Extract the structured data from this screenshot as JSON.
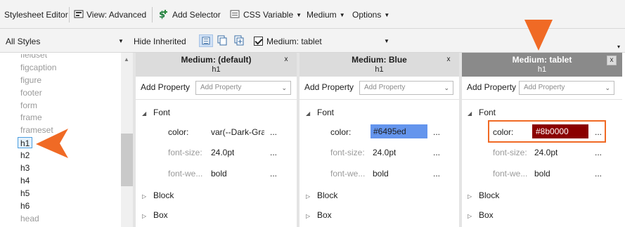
{
  "toolbar": {
    "title": "Stylesheet Editor",
    "view_label": "View: Advanced",
    "add_selector_label": "Add Selector",
    "css_variable_label": "CSS Variable",
    "medium_label": "Medium",
    "options_label": "Options"
  },
  "filter_bar": {
    "styles_value": "All Styles",
    "hide_inherited_label": "Hide Inherited",
    "medium_checkbox_label": "Medium: tablet"
  },
  "selector_list": {
    "items": [
      "fieldset",
      "figcaption",
      "figure",
      "footer",
      "form",
      "frame",
      "frameset",
      "h1",
      "h2",
      "h3",
      "h4",
      "h5",
      "h6",
      "head"
    ],
    "selected": "h1"
  },
  "columns": [
    {
      "title": "Medium: (default)",
      "subtitle": "h1",
      "add_property_label": "Add Property",
      "add_property_placeholder": "Add Property",
      "groups": [
        "Font",
        "Block",
        "Box"
      ],
      "props": [
        {
          "name": "color:",
          "value": "var(--Dark-Gra",
          "more": "..."
        },
        {
          "name": "font-size:",
          "value": "24.0pt",
          "more": "..."
        },
        {
          "name": "font-we...",
          "value": "bold",
          "more": "..."
        }
      ],
      "close": "x"
    },
    {
      "title": "Medium: Blue",
      "subtitle": "h1",
      "add_property_label": "Add Property",
      "add_property_placeholder": "Add Property",
      "groups": [
        "Font",
        "Block",
        "Box"
      ],
      "props": [
        {
          "name": "color:",
          "value": "#6495ed",
          "more": "..."
        },
        {
          "name": "font-size:",
          "value": "24.0pt",
          "more": "..."
        },
        {
          "name": "font-we...",
          "value": "bold",
          "more": "..."
        }
      ],
      "close": "x"
    },
    {
      "title": "Medium: tablet",
      "subtitle": "h1",
      "add_property_label": "Add Property",
      "add_property_placeholder": "Add Property",
      "groups": [
        "Font",
        "Block",
        "Box"
      ],
      "props": [
        {
          "name": "color:",
          "value": "#8b0000",
          "more": "..."
        },
        {
          "name": "font-size:",
          "value": "24.0pt",
          "more": "..."
        },
        {
          "name": "font-we...",
          "value": "bold",
          "more": "..."
        }
      ],
      "close": "x"
    }
  ],
  "colors": {
    "callout_orange": "#f06a25",
    "active_header": "#8a8a8a",
    "inactive_header": "#dcdcdc",
    "blue_swatch": "#6495ed",
    "red_swatch": "#8b0000"
  }
}
